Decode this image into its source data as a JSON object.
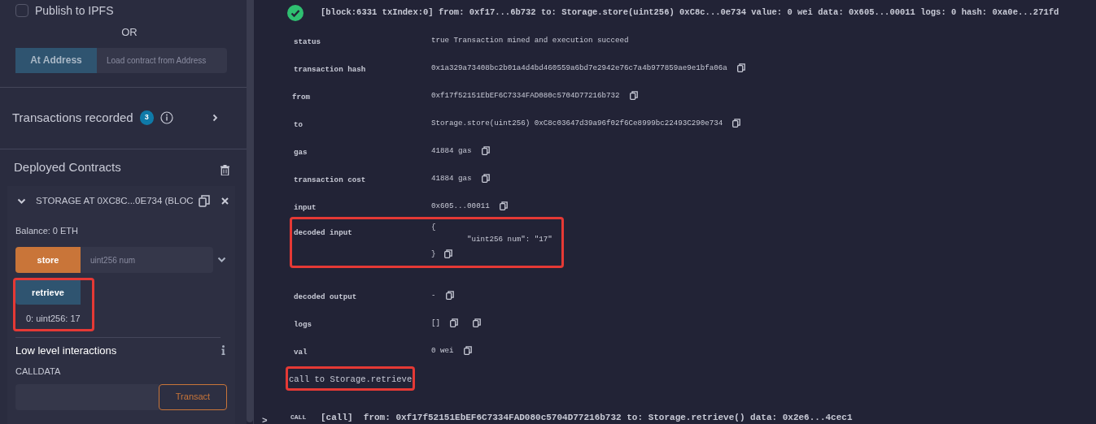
{
  "sidebar": {
    "publish_ipfs": {
      "label": "Publish to IPFS",
      "checked": false
    },
    "or_label": "OR",
    "at_address": {
      "button": "At Address",
      "placeholder": "Load contract from Address"
    },
    "transactions": {
      "label": "Transactions recorded",
      "count": "3"
    },
    "deployed": {
      "title": "Deployed Contracts"
    },
    "instance": {
      "title": "STORAGE AT 0XC8C...0E734 (BLOC",
      "expanded": true,
      "balance": "Balance: 0 ETH",
      "functions": [
        {
          "kind": "transact",
          "label": "store",
          "placeholder": "uint256 num",
          "highlighted": false
        },
        {
          "kind": "call",
          "label": "retrieve",
          "output": "0: uint256: 17",
          "highlighted": true
        }
      ]
    },
    "low_level": {
      "title": "Low level interactions",
      "calldata_label": "CALLDATA",
      "button": "Transact"
    }
  },
  "terminal": {
    "header": {
      "text": "[block:6331 txIndex:0] from: 0xf17...6b732 to: Storage.store(uint256) 0xC8c...0e734 value: 0 wei data: 0x605...00011 logs: 0 hash: 0xa0e...271fd"
    },
    "rows": [
      {
        "kind": "text",
        "key": "status",
        "value": "true Transaction mined and execution succeed",
        "highlighted": false
      },
      {
        "kind": "copy",
        "key": "transaction hash",
        "value": "0x1a329a73408bc2b01a4d4bd460559a6bd7e2942e76c7a4b977859ae9e1bfa06a",
        "highlighted": false
      },
      {
        "kind": "copy",
        "key": "from",
        "value": "0xf17f52151EbEF6C7334FAD080c5704D77216b732",
        "highlighted": false
      },
      {
        "kind": "copy",
        "key": "to",
        "value": "Storage.store(uint256) 0xC8c03647d39a96f02f6Ce8999bc22493C290e734",
        "highlighted": false
      },
      {
        "kind": "copy",
        "key": "gas",
        "value": "41884 gas",
        "highlighted": false
      },
      {
        "kind": "copy",
        "key": "transaction cost",
        "value": "41884 gas",
        "highlighted": false
      },
      {
        "kind": "copy",
        "key": "input",
        "value": "0x605...00011",
        "highlighted": false
      },
      {
        "kind": "json",
        "key": "decoded input",
        "open": "{",
        "entry": "\"uint256 num\": \"17\"",
        "close": "}",
        "highlighted": true
      },
      {
        "kind": "copy",
        "key": "decoded output",
        "value": "-",
        "highlighted": false
      },
      {
        "kind": "copy2",
        "key": "logs",
        "value": "[]",
        "highlighted": false
      },
      {
        "kind": "copy",
        "key": "val",
        "value": "0 wei",
        "highlighted": false
      }
    ],
    "note": {
      "text": "call to Storage.retrieve",
      "highlighted": true
    },
    "call": {
      "badge": "CALL",
      "text": "[call]  from: 0xf17f52151EbEF6C7334FAD080c5704D77216b732 to: Storage.retrieve() data: 0x2e6...4cec1"
    },
    "prompt": ">"
  }
}
